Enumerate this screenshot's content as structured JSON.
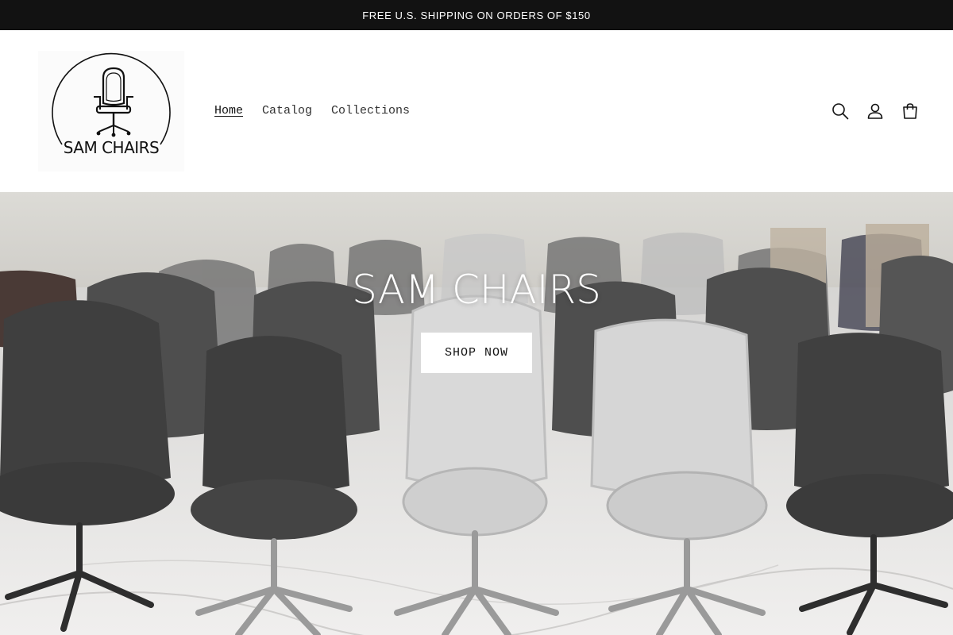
{
  "announcement": {
    "text": "FREE U.S. SHIPPING ON ORDERS OF $150"
  },
  "header": {
    "logo": {
      "text": "SAM CHAIRS",
      "icon": "chair-in-circle-logo"
    },
    "nav": [
      {
        "label": "Home",
        "active": true
      },
      {
        "label": "Catalog",
        "active": false
      },
      {
        "label": "Collections",
        "active": false
      }
    ],
    "icons": [
      "search-icon",
      "account-icon",
      "cart-icon"
    ]
  },
  "hero": {
    "title": "SAM CHAIRS",
    "button_label": "SHOP NOW",
    "image": "showroom-of-mesh-office-chairs"
  },
  "colors": {
    "announcement_bg": "#121212",
    "text_dark": "#121212",
    "nav_text": "#333333",
    "background": "#ffffff"
  }
}
